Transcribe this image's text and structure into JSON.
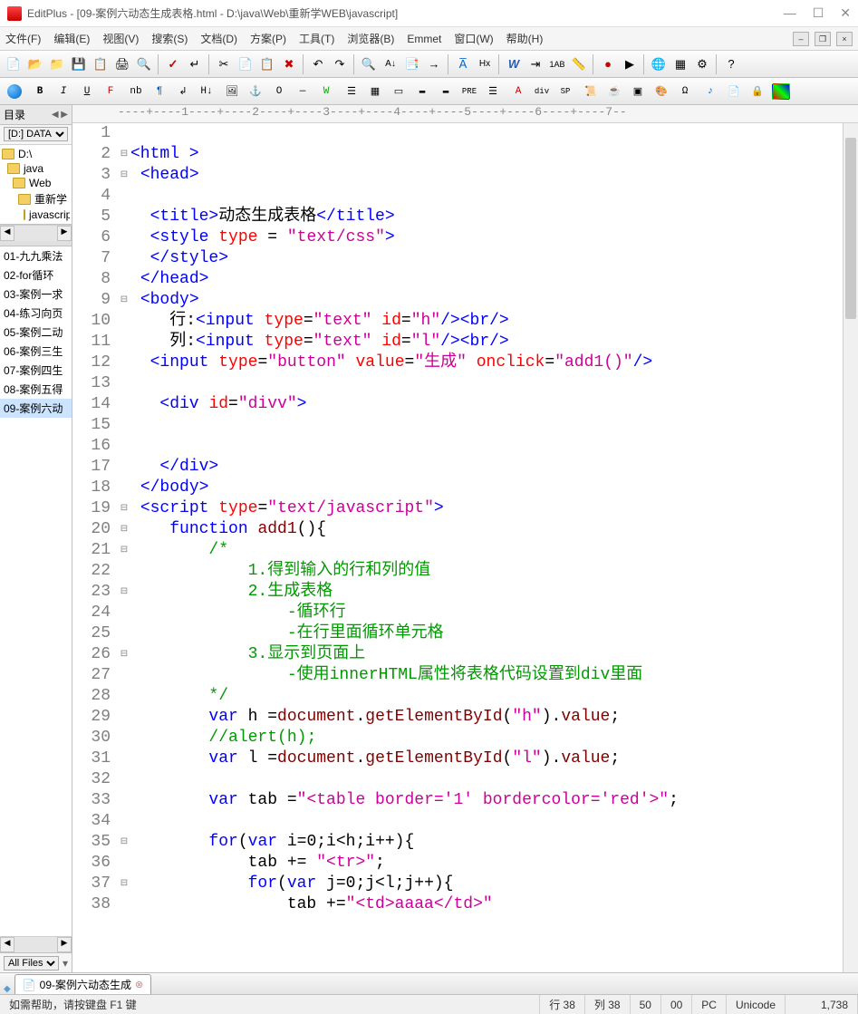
{
  "window": {
    "title": "EditPlus - [09-案例六动态生成表格.html - D:\\java\\Web\\重新学WEB\\javascript]"
  },
  "menu": {
    "file": "文件(F)",
    "edit": "编辑(E)",
    "view": "视图(V)",
    "search": "搜索(S)",
    "document": "文档(D)",
    "project": "方案(P)",
    "tools": "工具(T)",
    "browser": "浏览器(B)",
    "emmet": "Emmet",
    "window": "窗口(W)",
    "help": "帮助(H)"
  },
  "sidebar": {
    "header": "目录",
    "drive": "[D:] DATA",
    "tree": [
      "D:\\",
      "java",
      "Web",
      "重新学",
      "javascript"
    ],
    "files": [
      "01-九九乘法",
      "02-for循环",
      "03-案例一求",
      "04-练习向页",
      "05-案例二动",
      "06-案例三生",
      "07-案例四生",
      "08-案例五得",
      "09-案例六动"
    ],
    "selected_file_index": 8,
    "filter": "All Files"
  },
  "ruler": "----+----1----+----2----+----3----+----4----+----5----+----6----+----7--",
  "code_lines": [
    {
      "n": 1,
      "fold": "",
      "html": ""
    },
    {
      "n": 2,
      "fold": "⊟",
      "html": "<span class='tag'>&lt;html &gt;</span>"
    },
    {
      "n": 3,
      "fold": "⊟",
      "html": " <span class='tag'>&lt;head&gt;</span>"
    },
    {
      "n": 4,
      "fold": "",
      "html": ""
    },
    {
      "n": 5,
      "fold": "",
      "html": "  <span class='tag'>&lt;title&gt;</span>动态生成表格<span class='tag'>&lt;/title&gt;</span>"
    },
    {
      "n": 6,
      "fold": "",
      "html": "  <span class='tag'>&lt;style</span> <span class='attr'>type</span> = <span class='str'>\"text/css\"</span><span class='tag'>&gt;</span>"
    },
    {
      "n": 7,
      "fold": "",
      "html": "  <span class='tag'>&lt;/style&gt;</span>"
    },
    {
      "n": 8,
      "fold": "",
      "html": " <span class='tag'>&lt;/head&gt;</span>"
    },
    {
      "n": 9,
      "fold": "⊟",
      "html": " <span class='tag'>&lt;body&gt;</span>"
    },
    {
      "n": 10,
      "fold": "",
      "html": "    行:<span class='tag'>&lt;input</span> <span class='attr'>type</span>=<span class='str'>\"text\"</span> <span class='attr'>id</span>=<span class='str'>\"h\"</span><span class='tag'>/&gt;&lt;br/&gt;</span>"
    },
    {
      "n": 11,
      "fold": "",
      "html": "    列:<span class='tag'>&lt;input</span> <span class='attr'>type</span>=<span class='str'>\"text\"</span> <span class='attr'>id</span>=<span class='str'>\"l\"</span><span class='tag'>/&gt;&lt;br/&gt;</span>"
    },
    {
      "n": 12,
      "fold": "",
      "html": "  <span class='tag'>&lt;input</span> <span class='attr'>type</span>=<span class='str'>\"button\"</span> <span class='attr'>value</span>=<span class='str'>\"生成\"</span> <span class='attr'>onclick</span>=<span class='str'>\"add1()\"</span><span class='tag'>/&gt;</span>"
    },
    {
      "n": 13,
      "fold": "",
      "html": ""
    },
    {
      "n": 14,
      "fold": "",
      "html": "   <span class='tag'>&lt;div</span> <span class='attr'>id</span>=<span class='str'>\"divv\"</span><span class='tag'>&gt;</span>"
    },
    {
      "n": 15,
      "fold": "",
      "html": ""
    },
    {
      "n": 16,
      "fold": "",
      "html": ""
    },
    {
      "n": 17,
      "fold": "",
      "html": "   <span class='tag'>&lt;/div&gt;</span>"
    },
    {
      "n": 18,
      "fold": "",
      "html": " <span class='tag'>&lt;/body&gt;</span>"
    },
    {
      "n": 19,
      "fold": "⊟",
      "html": " <span class='tag'>&lt;script</span> <span class='attr'>type</span>=<span class='str'>\"text/javascript\"</span><span class='tag'>&gt;</span>"
    },
    {
      "n": 20,
      "fold": "⊟",
      "html": "    <span class='kw'>function</span> <span class='fn'>add1</span>(){"
    },
    {
      "n": 21,
      "fold": "⊟",
      "html": "        <span class='comment'>/*</span>"
    },
    {
      "n": 22,
      "fold": "",
      "html": "            <span class='comment'>1.得到输入的行和列的值</span>"
    },
    {
      "n": 23,
      "fold": "⊟",
      "html": "            <span class='comment'>2.生成表格</span>"
    },
    {
      "n": 24,
      "fold": "",
      "html": "                <span class='comment'>-循环行</span>"
    },
    {
      "n": 25,
      "fold": "",
      "html": "                <span class='comment'>-在行里面循环单元格</span>"
    },
    {
      "n": 26,
      "fold": "⊟",
      "html": "            <span class='comment'>3.显示到页面上</span>"
    },
    {
      "n": 27,
      "fold": "",
      "html": "                <span class='comment'>-使用innerHTML属性将表格代码设置到div里面</span>"
    },
    {
      "n": 28,
      "fold": "",
      "html": "        <span class='comment'>*/</span>"
    },
    {
      "n": 29,
      "fold": "",
      "html": "        <span class='kw'>var</span> h =<span class='fn'>document</span>.<span class='fn'>getElementById</span>(<span class='str'>\"h\"</span>).<span class='fn'>value</span>;"
    },
    {
      "n": 30,
      "fold": "",
      "html": "        <span class='comment'>//alert(h);</span>"
    },
    {
      "n": 31,
      "fold": "",
      "html": "        <span class='kw'>var</span> l =<span class='fn'>document</span>.<span class='fn'>getElementById</span>(<span class='str'>\"l\"</span>).<span class='fn'>value</span>;"
    },
    {
      "n": 32,
      "fold": "",
      "html": ""
    },
    {
      "n": 33,
      "fold": "",
      "html": "        <span class='kw'>var</span> tab =<span class='str'>\"&lt;table border='1' bordercolor='red'&gt;\"</span>;"
    },
    {
      "n": 34,
      "fold": "",
      "html": ""
    },
    {
      "n": 35,
      "fold": "⊟",
      "html": "        <span class='kw'>for</span>(<span class='kw'>var</span> i=0;i&lt;h;i++){"
    },
    {
      "n": 36,
      "fold": "",
      "html": "            tab += <span class='str'>\"&lt;tr&gt;\"</span>;"
    },
    {
      "n": 37,
      "fold": "⊟",
      "html": "            <span class='kw'>for</span>(<span class='kw'>var</span> j=0;j&lt;l;j++){"
    },
    {
      "n": 38,
      "fold": "",
      "html": "                tab +=<span class='str'>\"&lt;td&gt;aaaa&lt;/td&gt;\"</span>"
    }
  ],
  "tab": {
    "label": "09-案例六动态生成"
  },
  "status": {
    "help": "如需帮助，请按键盘 F1 键",
    "line": "行 38",
    "col": "列 38",
    "num": "50",
    "zero": "00",
    "pc": "PC",
    "encoding": "Unicode",
    "size": "1,738"
  },
  "toolbar2_labels": {
    "bold": "B",
    "italic": "I",
    "underline": "U",
    "font": "F",
    "nbsp": "nb",
    "para": "¶",
    "heading": "H↓",
    "obj": "O",
    "anchor": "⚓",
    "w": "W",
    "abl": "A",
    "hx": "Hx",
    "div": "div",
    "sp": "SP"
  }
}
